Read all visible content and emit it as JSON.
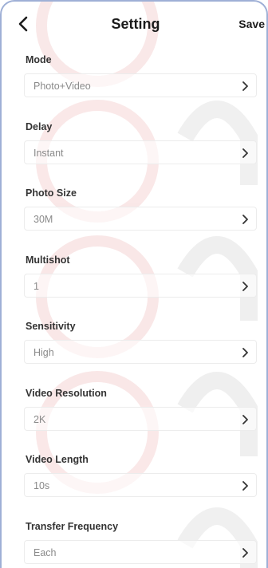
{
  "header": {
    "title": "Setting",
    "save_label": "Save",
    "back_icon": "back-arrow-icon"
  },
  "settings": [
    {
      "label": "Mode",
      "value": "Photo+Video"
    },
    {
      "label": "Delay",
      "value": "Instant"
    },
    {
      "label": "Photo Size",
      "value": "30M"
    },
    {
      "label": "Multishot",
      "value": "1"
    },
    {
      "label": "Sensitivity",
      "value": "High"
    },
    {
      "label": "Video Resolution",
      "value": "2K"
    },
    {
      "label": "Video Length",
      "value": "10s"
    },
    {
      "label": "Transfer Frequency",
      "value": "Each"
    }
  ],
  "colors": {
    "text_primary": "#1a1a1a",
    "label": "#333333",
    "value": "#8a8a8a",
    "frame_border": "#9fb0d6"
  }
}
